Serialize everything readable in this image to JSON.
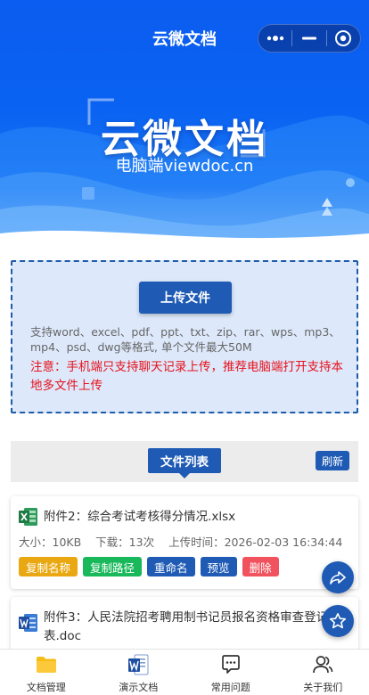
{
  "nav": {
    "title": "云微文档"
  },
  "hero": {
    "title": "云微文档",
    "subtitle": "电脑端viewdoc.cn"
  },
  "upload": {
    "button_label": "上传文件",
    "supported_formats": "支持word、excel、pdf、ppt、txt、zip、rar、wps、mp3、mp4、psd、dwg等格式, 单个文件最大50M",
    "note": "注意：手机端只支持聊天记录上传，推荐电脑端打开支持本地多文件上传"
  },
  "file_list": {
    "title": "文件列表",
    "refresh_label": "刷新",
    "files": [
      {
        "name": "附件2：综合考试考核得分情况.xlsx",
        "size": "大小：10KB",
        "downloads": "下载：13次",
        "upload_time": "上传时间：2026-02-03 16:34:44",
        "type_icon": "excel-icon"
      },
      {
        "name": "附件3：人民法院招考聘用制书记员报名资格审查登记表.doc",
        "type_icon": "word-icon"
      }
    ],
    "actions": [
      {
        "label": "复制名称",
        "color": "#e9a812"
      },
      {
        "label": "复制路径",
        "color": "#19b85a"
      },
      {
        "label": "重命名",
        "color": "#1f5bb5"
      },
      {
        "label": "预览",
        "color": "#1f5bb5"
      },
      {
        "label": "删除",
        "color": "#f0525e"
      }
    ]
  },
  "floating": {
    "share_icon": "share-icon",
    "star_icon": "star-icon"
  },
  "tabbar": {
    "items": [
      {
        "label": "文档管理",
        "icon": "folder-icon"
      },
      {
        "label": "演示文档",
        "icon": "word-doc-icon"
      },
      {
        "label": "常用问题",
        "icon": "chat-icon"
      },
      {
        "label": "关于我们",
        "icon": "users-icon"
      }
    ]
  },
  "colors": {
    "primary": "#1f5bb5",
    "warning_text": "#e8121c",
    "hero_blue": "#0b5cf0"
  }
}
